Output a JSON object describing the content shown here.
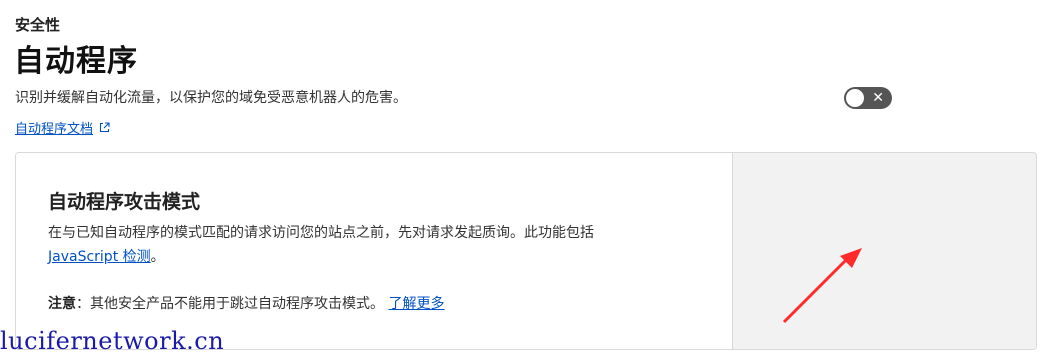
{
  "header": {
    "breadcrumb": "安全性",
    "title": "自动程序",
    "description": "识别并缓解自动化流量，以保护您的域免受恶意机器人的危害。",
    "docs_link": "自动程序文档"
  },
  "card": {
    "title": "自动程序攻击模式",
    "desc_prefix": "在与已知自动程序的模式匹配的请求访问您的站点之前，先对请求发起质询。此功能包括",
    "desc_link": "JavaScript 检测",
    "desc_suffix": "。",
    "note_label": "注意",
    "note_text": "：其他安全产品不能用于跳过自动程序攻击模式。",
    "note_link": "了解更多",
    "toggle_state": "off",
    "toggle_off_glyph": "✕"
  },
  "annotation": {
    "arrow_color": "#ff2a2a"
  },
  "watermark": "lucifernetwork.cn"
}
